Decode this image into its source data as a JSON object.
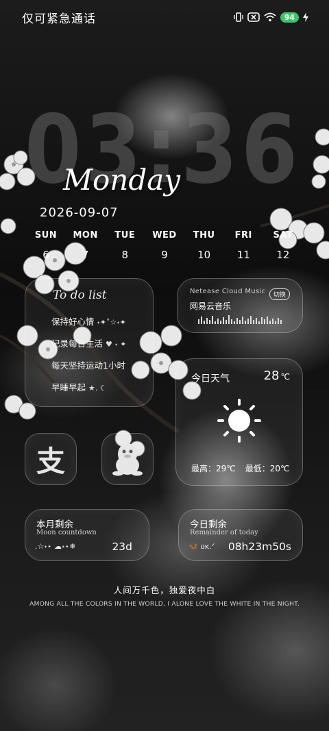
{
  "status_bar": {
    "carrier": "仅可紧急通话",
    "battery": "94",
    "icons": [
      "vibrate-icon",
      "no-sim-icon",
      "wifi-icon",
      "battery-icon",
      "charging-icon"
    ]
  },
  "clock": {
    "time": "03:36",
    "day": "Monday",
    "date": "2026-09-07"
  },
  "week": [
    {
      "name": "SUN",
      "day": "6"
    },
    {
      "name": "MON",
      "day": "7"
    },
    {
      "name": "TUE",
      "day": "8"
    },
    {
      "name": "WED",
      "day": "9"
    },
    {
      "name": "THU",
      "day": "10"
    },
    {
      "name": "FRI",
      "day": "11"
    },
    {
      "name": "SAT",
      "day": "12"
    }
  ],
  "todo": {
    "title": "To do list",
    "items": [
      {
        "text": "保持好心情",
        "deco": "˖✦˚☆˖✦"
      },
      {
        "text": "记录每日生活",
        "deco": "♥ ˖ ✦"
      },
      {
        "text": "每天坚持运动1小时",
        "deco": ""
      },
      {
        "text": "早睡早起",
        "deco": "★. ☾"
      }
    ]
  },
  "music": {
    "brand": "Netease Cloud Music",
    "switch_label": "切换",
    "title": "网易云音乐"
  },
  "weather": {
    "label": "今日天气",
    "temp": "28",
    "unit": "℃",
    "icon": "sun-icon",
    "high": "最高：29℃",
    "low": "最低：20℃"
  },
  "apps": {
    "alipay_glyph": "支",
    "qq_icon": "qq-penguin-icon"
  },
  "moon_countdown": {
    "title": "本月剩余",
    "subtitle": "Moon countdown",
    "deco": ".☆˖⋆ ☁˖⋆❄",
    "value": "23d"
  },
  "today_remainder": {
    "title": "今日剩余",
    "subtitle": "Remainder of today",
    "deco": "🦋 ʋᴋ.ᐟ",
    "value": "08h23m50s"
  },
  "quote": {
    "cn": "人间万千色，独爱夜中白",
    "en": "AMONG ALL THE COLORS IN THE WORLD, I ALONE LOVE THE WHITE IN THE NIGHT."
  },
  "colors": {
    "battery": "#39c66a",
    "text": "#ffffff"
  }
}
